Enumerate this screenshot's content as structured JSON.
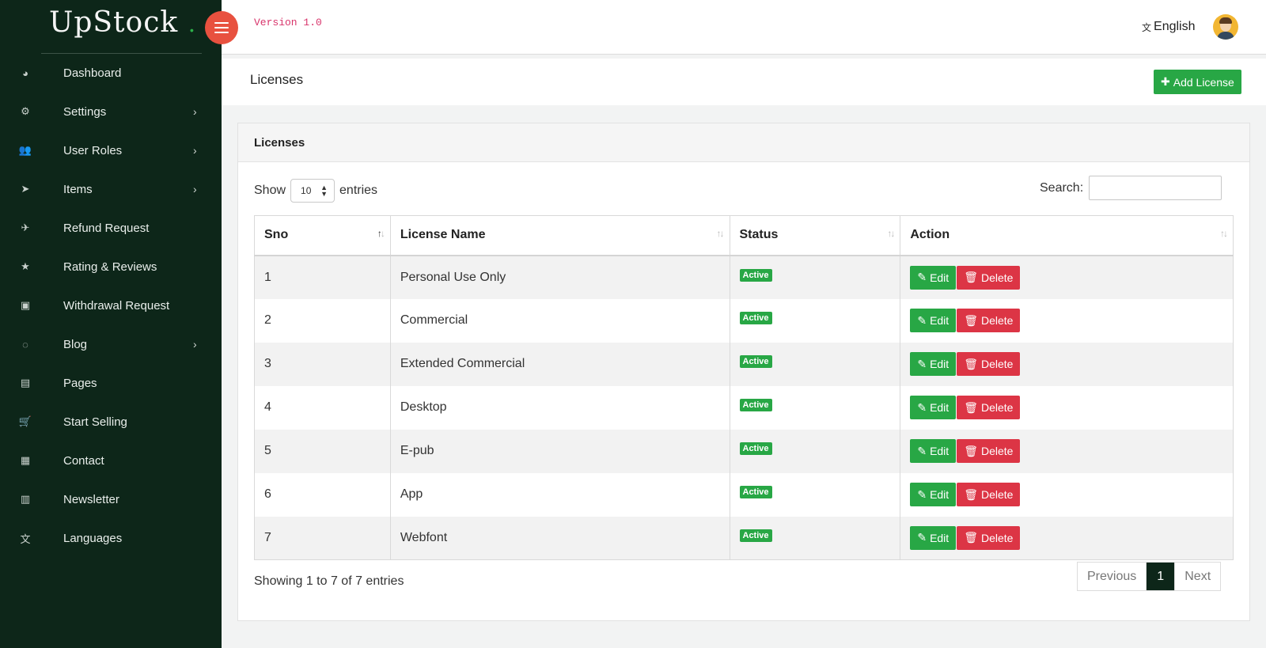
{
  "brand": {
    "name": "UpStock",
    "dot": "."
  },
  "header": {
    "version": "Version 1.0",
    "language": "English",
    "language_icon": "translate-icon"
  },
  "sidebar": {
    "items": [
      {
        "label": "Dashboard",
        "icon": "dashboard-icon",
        "glyph": "◕",
        "has_submenu": false
      },
      {
        "label": "Settings",
        "icon": "gears-icon",
        "glyph": "⚙",
        "has_submenu": true
      },
      {
        "label": "User Roles",
        "icon": "users-icon",
        "glyph": "👥",
        "has_submenu": true
      },
      {
        "label": "Items",
        "icon": "location-arrow-icon",
        "glyph": "➤",
        "has_submenu": true
      },
      {
        "label": "Refund Request",
        "icon": "paper-plane-icon",
        "glyph": "✈",
        "has_submenu": false
      },
      {
        "label": "Rating & Reviews",
        "icon": "star-icon",
        "glyph": "★",
        "has_submenu": false
      },
      {
        "label": "Withdrawal Request",
        "icon": "money-icon",
        "glyph": "▣",
        "has_submenu": false
      },
      {
        "label": "Blog",
        "icon": "comments-icon",
        "glyph": "◌",
        "has_submenu": true
      },
      {
        "label": "Pages",
        "icon": "file-text-icon",
        "glyph": "▤",
        "has_submenu": false
      },
      {
        "label": "Start Selling",
        "icon": "cart-icon",
        "glyph": "🛒",
        "has_submenu": false
      },
      {
        "label": "Contact",
        "icon": "address-book-icon",
        "glyph": "▦",
        "has_submenu": false
      },
      {
        "label": "Newsletter",
        "icon": "newspaper-icon",
        "glyph": "▥",
        "has_submenu": false
      },
      {
        "label": "Languages",
        "icon": "language-icon",
        "glyph": "文",
        "has_submenu": false
      }
    ]
  },
  "page": {
    "title": "Licenses",
    "add_button": "Add License"
  },
  "card": {
    "title": "Licenses",
    "show_label": "Show",
    "entries_value": "10",
    "entries_label": "entries",
    "search_label": "Search:",
    "search_value": ""
  },
  "table": {
    "columns": [
      "Sno",
      "License Name",
      "Status",
      "Action"
    ],
    "edit_label": "Edit",
    "delete_label": "Delete",
    "rows": [
      {
        "sno": "1",
        "name": "Personal Use Only",
        "status": "Active"
      },
      {
        "sno": "2",
        "name": "Commercial",
        "status": "Active"
      },
      {
        "sno": "3",
        "name": "Extended Commercial",
        "status": "Active"
      },
      {
        "sno": "4",
        "name": "Desktop",
        "status": "Active"
      },
      {
        "sno": "5",
        "name": "E-pub",
        "status": "Active"
      },
      {
        "sno": "6",
        "name": "App",
        "status": "Active"
      },
      {
        "sno": "7",
        "name": "Webfont",
        "status": "Active"
      }
    ]
  },
  "footer": {
    "info": "Showing 1 to 7 of 7 entries",
    "previous": "Previous",
    "current_page": "1",
    "next": "Next"
  },
  "colors": {
    "sidebar_bg": "#0d2619",
    "accent_green": "#28a745",
    "danger_red": "#dc3545",
    "toggle_red": "#e8513f"
  }
}
